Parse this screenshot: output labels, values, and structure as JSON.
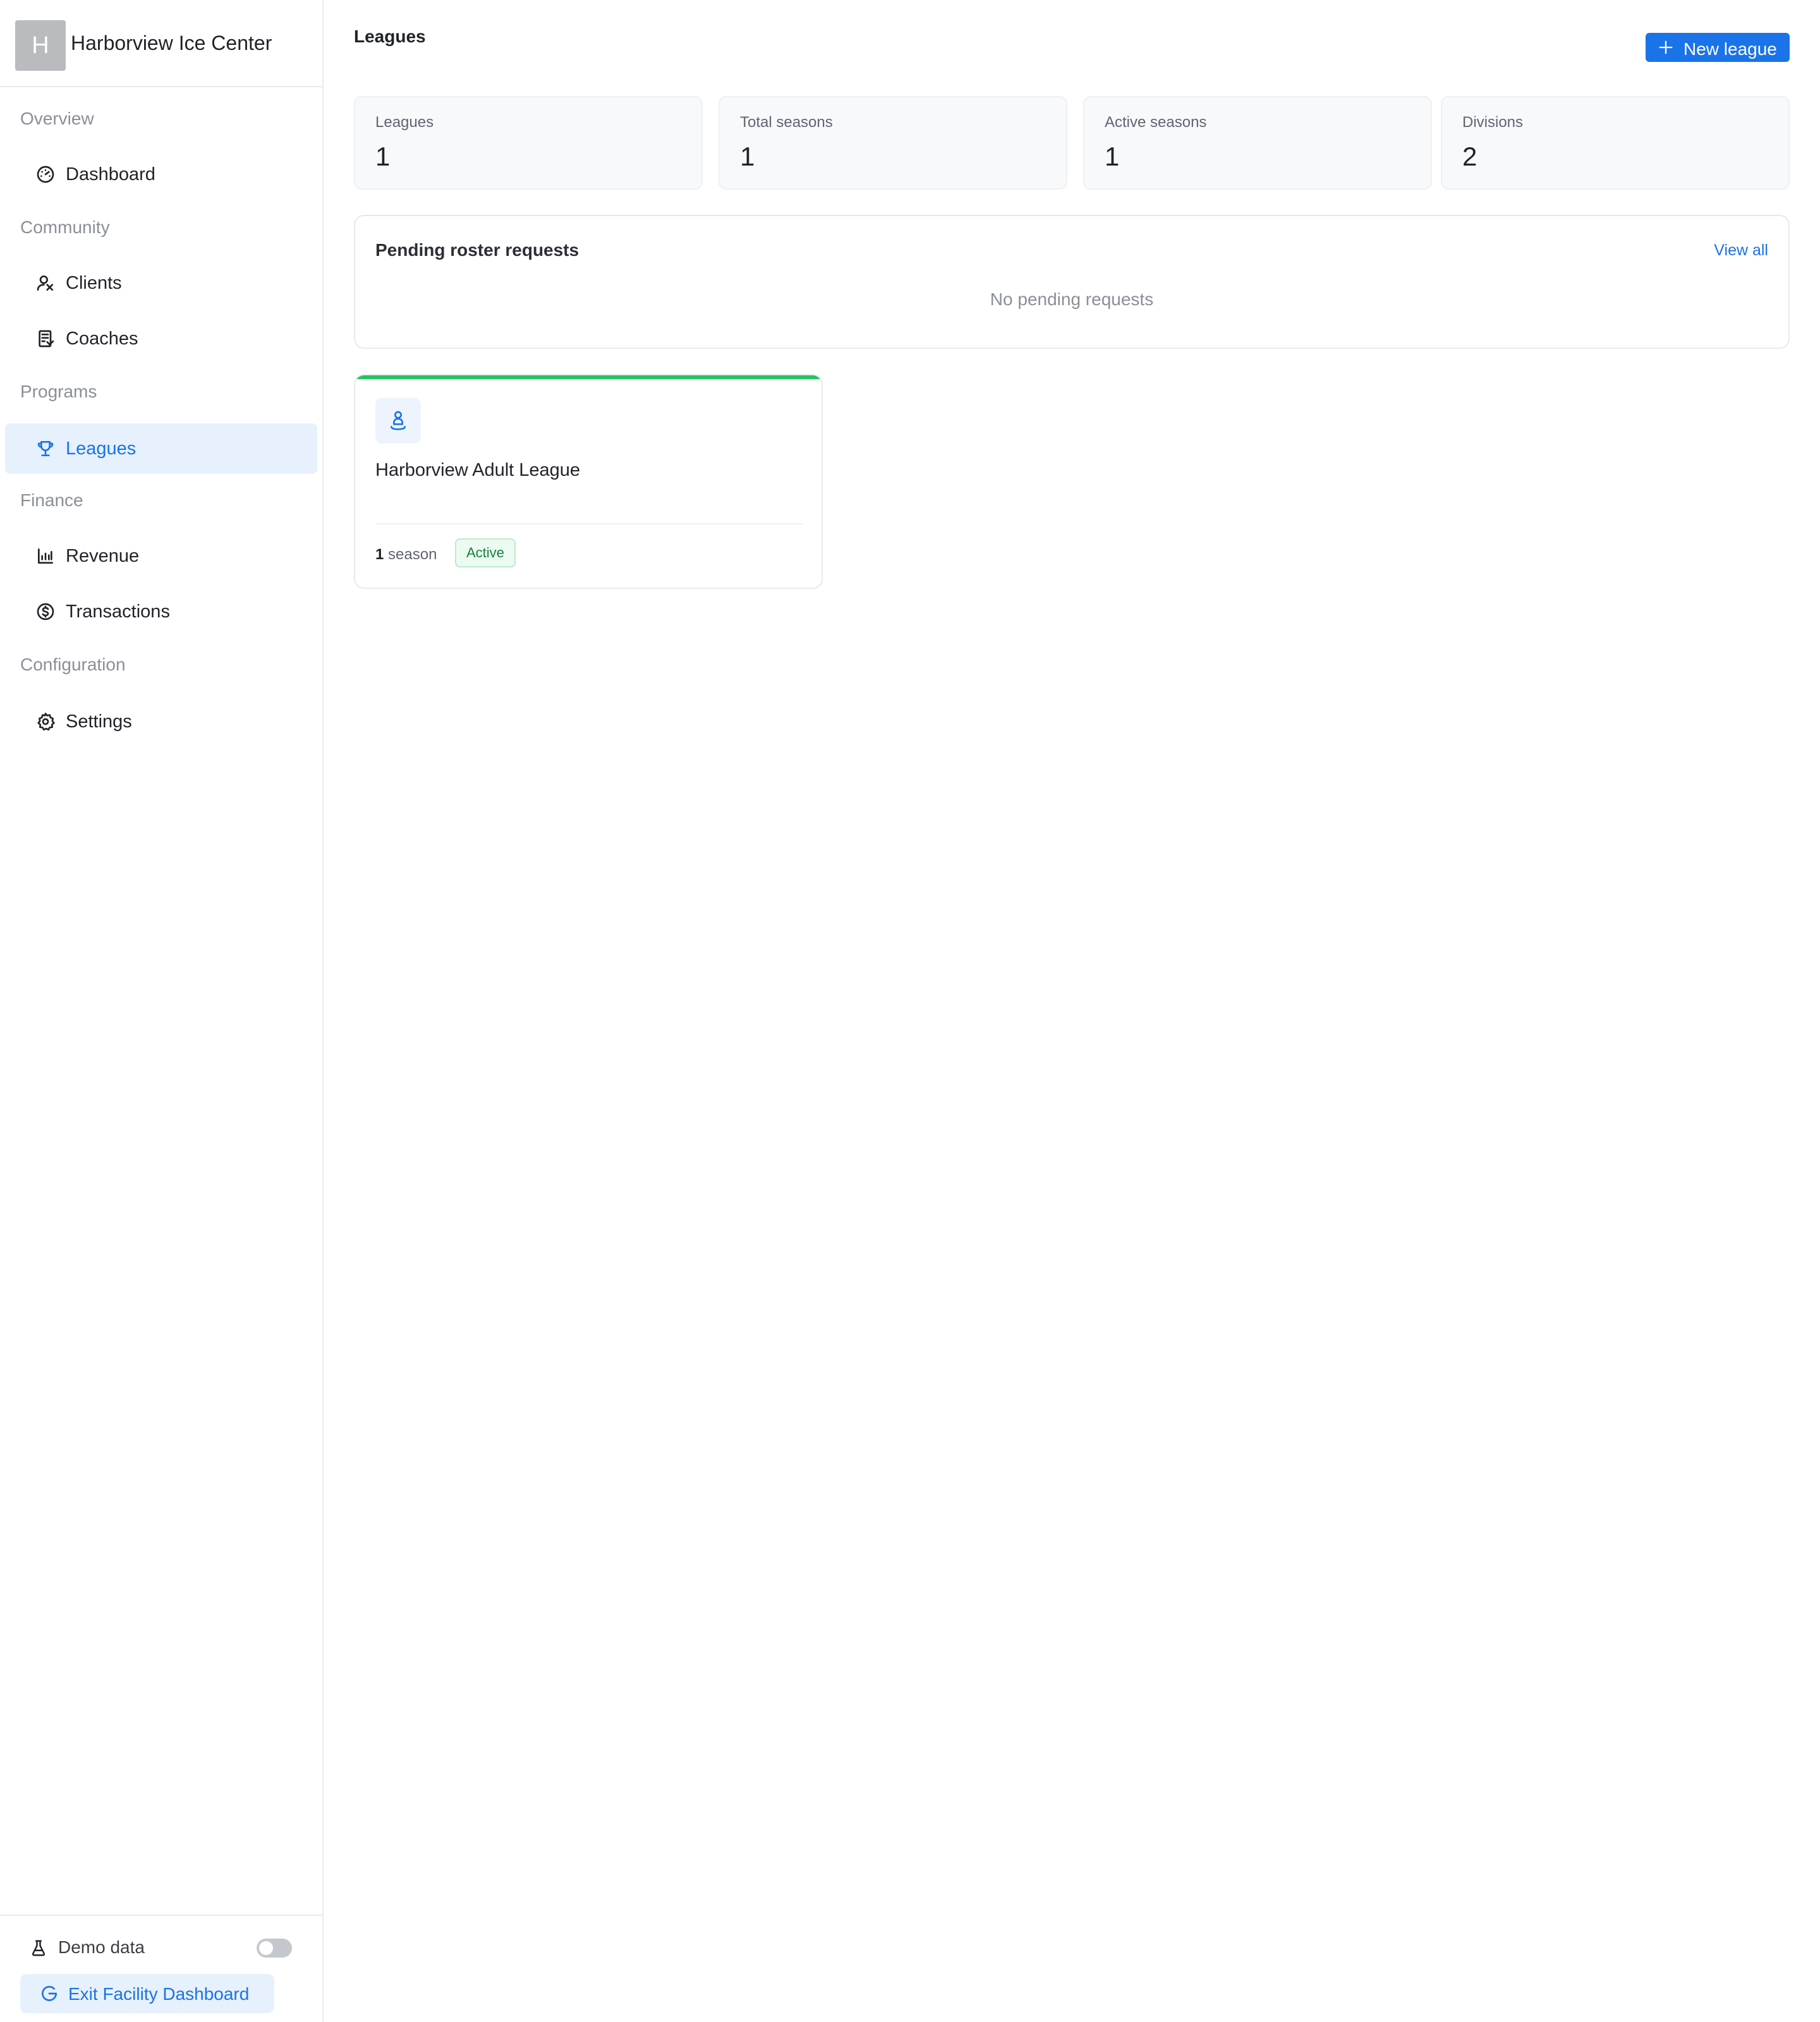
{
  "brand": {
    "initial": "H",
    "name": "Harborview Ice Center"
  },
  "nav": {
    "sections": [
      {
        "label": "Overview"
      },
      {
        "label": "Community"
      },
      {
        "label": "Programs"
      },
      {
        "label": "Finance"
      },
      {
        "label": "Configuration"
      }
    ],
    "items": [
      {
        "label": "Dashboard",
        "icon": "gauge-icon"
      },
      {
        "label": "Clients",
        "icon": "users-icon"
      },
      {
        "label": "Coaches",
        "icon": "clipboard-icon"
      },
      {
        "label": "Leagues",
        "icon": "trophy-icon",
        "active": true
      },
      {
        "label": "Revenue",
        "icon": "bar-chart-icon"
      },
      {
        "label": "Transactions",
        "icon": "dollar-circle-icon"
      },
      {
        "label": "Settings",
        "icon": "gear-icon"
      }
    ]
  },
  "footer": {
    "demo_label": "Demo data",
    "demo_enabled": false,
    "exit_label": "Exit Facility Dashboard"
  },
  "header": {
    "title": "Leagues",
    "new_button_label": "New league"
  },
  "stats": [
    {
      "label": "Leagues",
      "value": "1"
    },
    {
      "label": "Total seasons",
      "value": "1"
    },
    {
      "label": "Active seasons",
      "value": "1"
    },
    {
      "label": "Divisions",
      "value": "2"
    }
  ],
  "pending": {
    "title": "Pending roster requests",
    "link": "View all",
    "empty": "No pending requests"
  },
  "leagues": [
    {
      "name": "Harborview Adult League",
      "season_count": "1",
      "season_label": "season",
      "status": "Active"
    }
  ],
  "colors": {
    "accent": "#1a73e8",
    "active_nav_bg": "#e6f1fd",
    "status_active": "#22c55e"
  }
}
